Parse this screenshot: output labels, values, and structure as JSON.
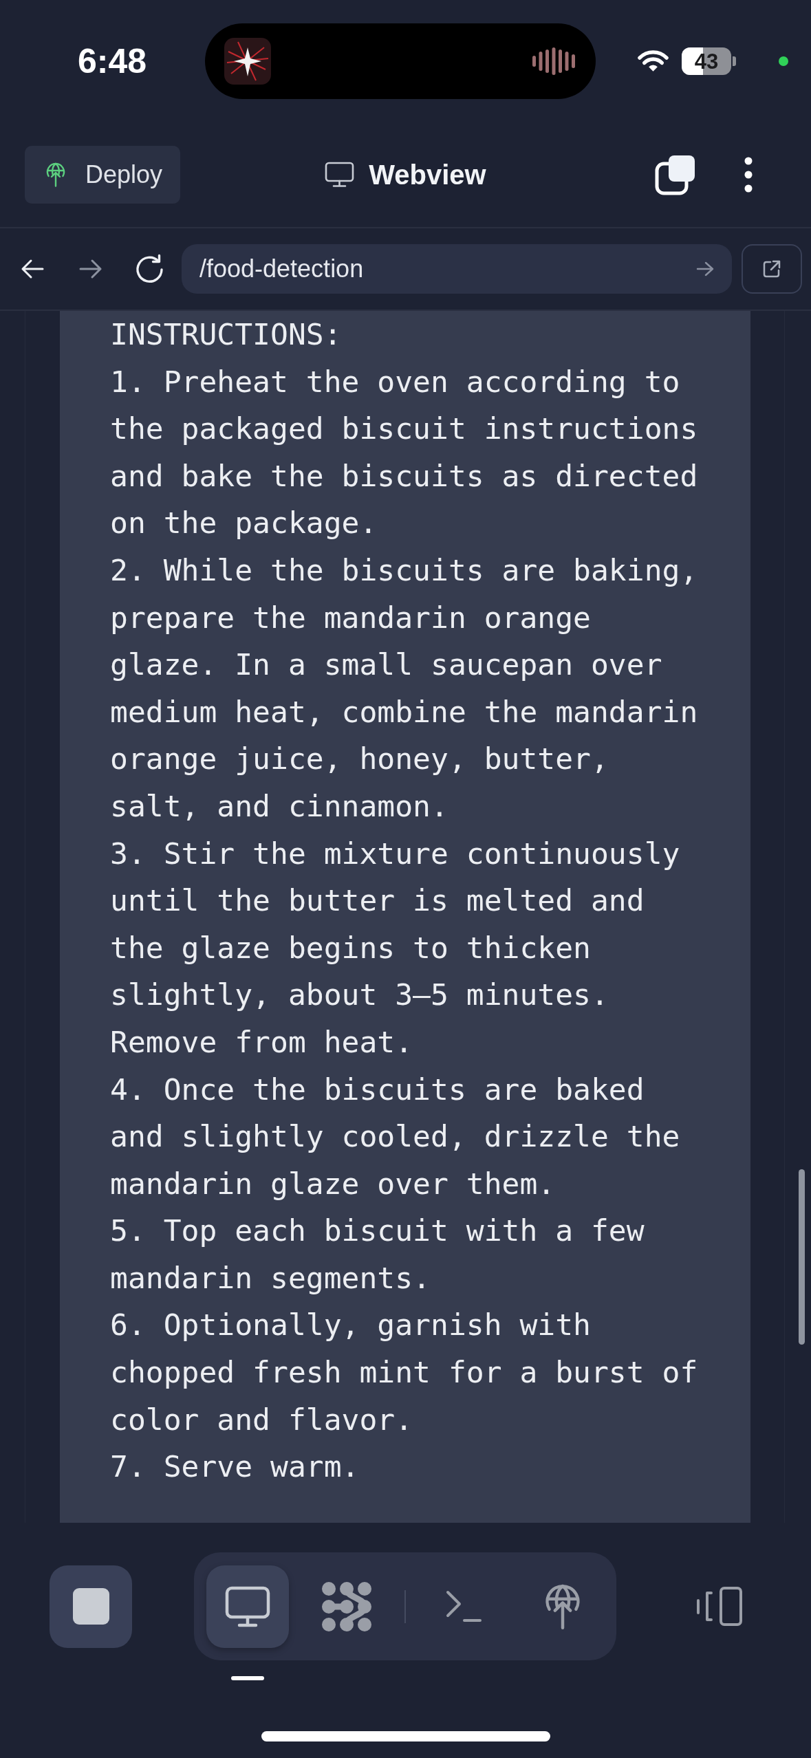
{
  "status_bar": {
    "time": "6:48",
    "battery": "43"
  },
  "header": {
    "deploy_button": "Deploy",
    "title": "Webview"
  },
  "address_bar": {
    "url": "/food-detection"
  },
  "content": {
    "heading": "INSTRUCTIONS:",
    "steps": [
      "1. Preheat the oven according to the packaged biscuit instructions and bake the biscuits as directed on the package.",
      "2. While the biscuits are baking, prepare the mandarin orange glaze. In a small saucepan over medium heat, combine the mandarin orange juice, honey, butter, salt, and cinnamon.",
      "3. Stir the mixture continuously until the butter is melted and the glaze begins to thicken slightly, about 3–5 minutes. Remove from heat.",
      "4. Once the biscuits are baked and slightly cooled, drizzle the mandarin glaze over them.",
      "5. Top each biscuit with a few mandarin segments.",
      "6. Optionally, garnish with chopped fresh mint for a burst of color and flavor.",
      "7. Serve warm."
    ]
  },
  "bottom_bar": {
    "tabs": [
      {
        "kind": "preview",
        "selected": true
      },
      {
        "kind": "agents",
        "selected": false
      },
      {
        "kind": "shell",
        "selected": false
      },
      {
        "kind": "deploy",
        "selected": false
      }
    ]
  }
}
